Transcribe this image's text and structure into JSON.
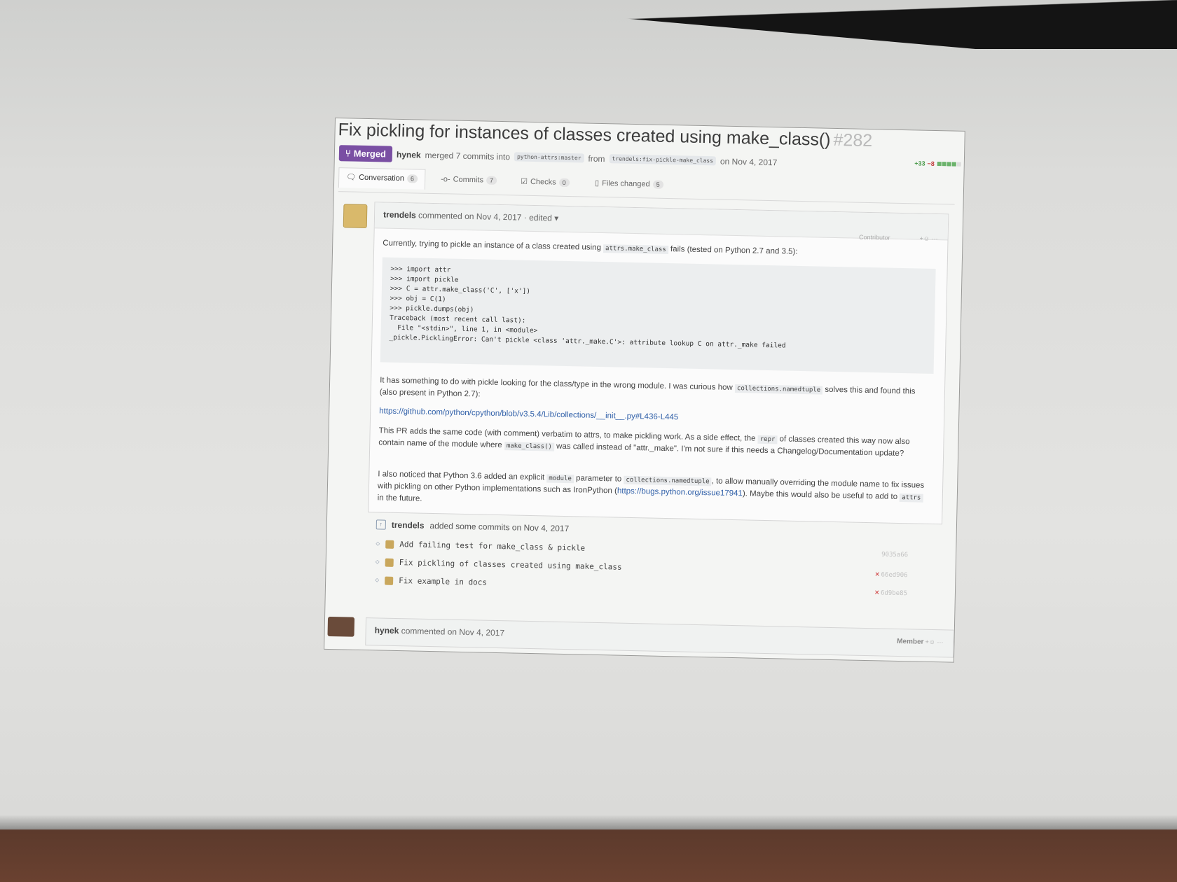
{
  "pr": {
    "title": "Fix pickling for instances of classes created using make_class()",
    "number": "#282",
    "state": "Merged",
    "author": "hynek",
    "merged_text": "merged 7 commits into",
    "base_branch": "python-attrs:master",
    "from_word": "from",
    "head_branch": "trendels:fix-pickle-make_class",
    "date": "on Nov 4, 2017"
  },
  "tabs": [
    {
      "label": "Conversation",
      "count": "6"
    },
    {
      "label": "Commits",
      "count": "7"
    },
    {
      "label": "Checks",
      "count": "0"
    },
    {
      "label": "Files changed",
      "count": "5"
    }
  ],
  "diffstat": {
    "added": "+33",
    "removed": "−8"
  },
  "comment": {
    "author": "trendels",
    "meta": "commented on Nov 4, 2017 · edited ▾",
    "role": "Contributor",
    "p1_a": "Currently, trying to pickle an instance of a class created using",
    "p1_code": "attrs.make_class",
    "p1_b": "fails (tested on Python 2.7 and 3.5):",
    "code": ">>> import attr\n>>> import pickle\n>>> C = attr.make_class('C', ['x'])\n>>> obj = C(1)\n>>> pickle.dumps(obj)\nTraceback (most recent call last):\n  File \"<stdin>\", line 1, in <module>\n_pickle.PicklingError: Can't pickle <class 'attr._make.C'>: attribute lookup C on attr._make failed",
    "p2_a": "It has something to do with pickle looking for the class/type in the wrong module. I was curious how",
    "p2_code": "collections.namedtuple",
    "p2_b": "solves this and found this (also present in Python 2.7):",
    "link1": "https://github.com/python/cpython/blob/v3.5.4/Lib/collections/__init__.py#L436-L445",
    "p3_a": "This PR adds the same code (with comment) verbatim to attrs, to make pickling work. As a side effect, the",
    "p3_code1": "repr",
    "p3_b": "of classes created this way now also contain name of the module where",
    "p3_code2": "make_class()",
    "p3_c": "was called instead of \"attr._make\". I'm not sure if this needs a Changelog/Documentation update?",
    "p4_a": "I also noticed that Python 3.6 added an explicit",
    "p4_code1": "module",
    "p4_b": "parameter to",
    "p4_code2": "collections.namedtuple",
    "p4_c": ", to allow manually overriding the module name to fix issues with pickling on other Python implementations such as IronPython (",
    "link2": "https://bugs.python.org/issue17941",
    "p4_d": "). Maybe this would also be useful to add to",
    "p4_code3": "attrs",
    "p4_e": "in the future."
  },
  "timeline": {
    "author": "trendels",
    "text": "added some commits on Nov 4, 2017",
    "commits": [
      {
        "message": "Add failing test for make_class & pickle",
        "sha": "9035a66",
        "failed": false
      },
      {
        "message": "Fix pickling of classes created using make_class",
        "sha": "66ed906",
        "failed": true
      },
      {
        "message": "Fix example in docs",
        "sha": "6d9be85",
        "failed": true
      }
    ]
  },
  "next_comment": {
    "author": "hynek",
    "meta": "commented on Nov 4, 2017",
    "role": "Member"
  }
}
